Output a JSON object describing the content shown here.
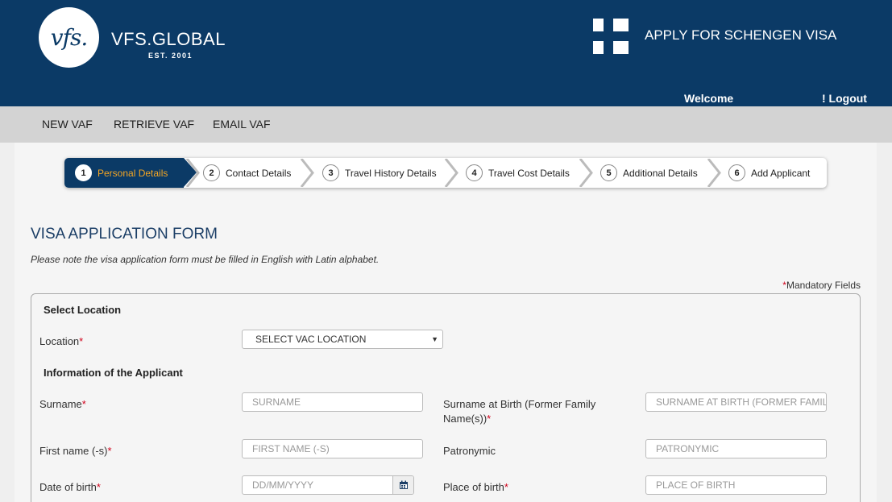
{
  "header": {
    "brand_mark": "vfs.",
    "brand_name": "VFS.GLOBAL",
    "brand_est": "EST. 2001",
    "apply_title": "APPLY FOR SCHENGEN VISA",
    "welcome": "Welcome",
    "logout": "! Logout"
  },
  "nav": {
    "items": [
      "NEW VAF",
      "RETRIEVE VAF",
      "EMAIL VAF"
    ]
  },
  "stepper": {
    "steps": [
      {
        "num": "1",
        "label": "Personal Details"
      },
      {
        "num": "2",
        "label": "Contact Details"
      },
      {
        "num": "3",
        "label": "Travel History Details"
      },
      {
        "num": "4",
        "label": "Travel Cost Details"
      },
      {
        "num": "5",
        "label": "Additional Details"
      },
      {
        "num": "6",
        "label": "Add Applicant"
      }
    ]
  },
  "form": {
    "title": "VISA APPLICATION FORM",
    "note": "Please note the visa application form must be filled in English with Latin alphabet.",
    "mandatory_star": "*",
    "mandatory_text": "Mandatory Fields",
    "section_location": "Select Location",
    "location_label": "Location",
    "location_select": "SELECT VAC LOCATION",
    "section_applicant": "Information of the Applicant",
    "surname_label": "Surname",
    "surname_placeholder": "SURNAME",
    "surname_birth_label": "Surname at Birth (Former Family Name(s))",
    "surname_birth_placeholder": "SURNAME AT BIRTH (FORMER FAMILY NAME(S))",
    "firstname_label": "First name (-s)",
    "firstname_placeholder": "FIRST NAME (-S)",
    "patronymic_label": "Patronymic",
    "patronymic_placeholder": "PATRONYMIC",
    "dob_label": "Date of birth",
    "dob_placeholder": "DD/MM/YYYY",
    "pob_label": "Place of birth",
    "pob_placeholder": "PLACE OF BIRTH"
  },
  "colors": {
    "header_bg": "#0b3a66",
    "active_step_text": "#f5a623",
    "required": "#d0021b"
  },
  "icons": {
    "dropdown": "caret-down-icon",
    "calendar": "calendar-icon",
    "flag": "finland-flag-icon"
  }
}
